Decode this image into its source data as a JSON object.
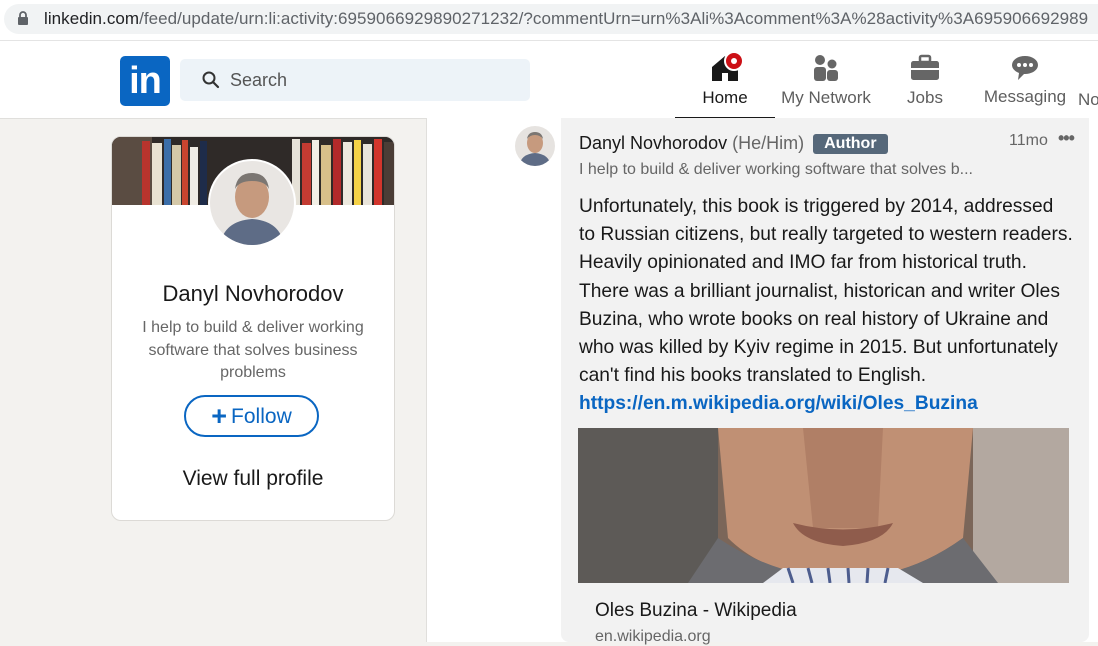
{
  "browser": {
    "url_domain": "linkedin.com",
    "url_path": "/feed/update/urn:li:activity:6959066929890271232/?commentUrn=urn%3Ali%3Acomment%3A%28activity%3A695906692989"
  },
  "nav": {
    "logo_text": "in",
    "search_placeholder": "Search",
    "items": [
      {
        "label": "Home",
        "icon": "home-icon",
        "active": true
      },
      {
        "label": "My Network",
        "icon": "people-icon"
      },
      {
        "label": "Jobs",
        "icon": "briefcase-icon"
      },
      {
        "label": "Messaging",
        "icon": "chat-icon"
      },
      {
        "label": "No",
        "icon": "bell-icon"
      }
    ]
  },
  "profile_card": {
    "name": "Danyl Novhorodov",
    "description": "I help to build & deliver working software that solves business problems",
    "follow_label": "Follow",
    "view_profile_label": "View full profile"
  },
  "comment": {
    "author_name": "Danyl Novhorodov",
    "pronouns": "(He/Him)",
    "author_badge": "Author",
    "time": "11mo",
    "more": "•••",
    "headline": "I help to build & deliver working software that solves b...",
    "text": "Unfortunately, this book is triggered by 2014, addressed to Russian citizens, but really targeted to western readers. Heavily opinionated and IMO far from historical truth. There was a brilliant journalist, historican and writer Oles Buzina, who wrote books on real history of Ukraine and who was killed by Kyiv regime in 2015. But unfortunately can't find his books translated to English.",
    "link": "https://en.m.wikipedia.org/wiki/Oles_Buzina",
    "preview_title": "Oles Buzina - Wikipedia",
    "preview_source": "en.wikipedia.org"
  },
  "colors": {
    "brand": "#0a66c2",
    "notification": "#cc1016",
    "author_badge_bg": "#56687a"
  }
}
